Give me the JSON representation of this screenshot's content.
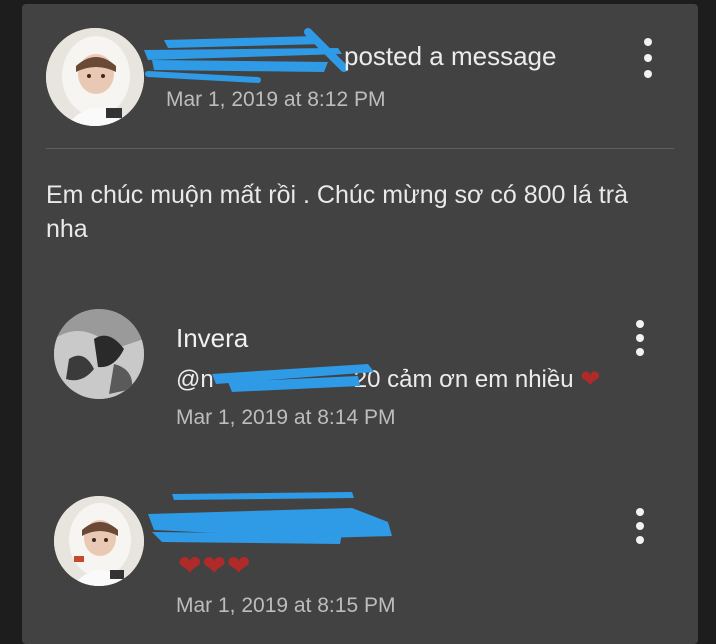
{
  "post": {
    "action_text": "posted a message",
    "timestamp": "Mar 1, 2019 at 8:12 PM",
    "message": "Em chúc muộn mất rồi . Chúc mừng sơ có 800 lá trà nha",
    "author_name_redacted": true
  },
  "replies": [
    {
      "author": "Invera",
      "mention_prefix": "@n",
      "mention_suffix": "20",
      "text": " cảm ơn em nhiều ",
      "heart": "❤",
      "timestamp": "Mar 1, 2019 at 8:14 PM"
    },
    {
      "author_redacted": true,
      "hearts": "❤❤❤",
      "timestamp": "Mar 1, 2019 at 8:15 PM"
    }
  ],
  "icons": {
    "menu": "more-vert-icon",
    "heart": "heart-icon"
  },
  "colors": {
    "card": "#424242",
    "background": "#1d1d1d",
    "redaction": "#2f9be6",
    "heart": "#b12a2a"
  }
}
